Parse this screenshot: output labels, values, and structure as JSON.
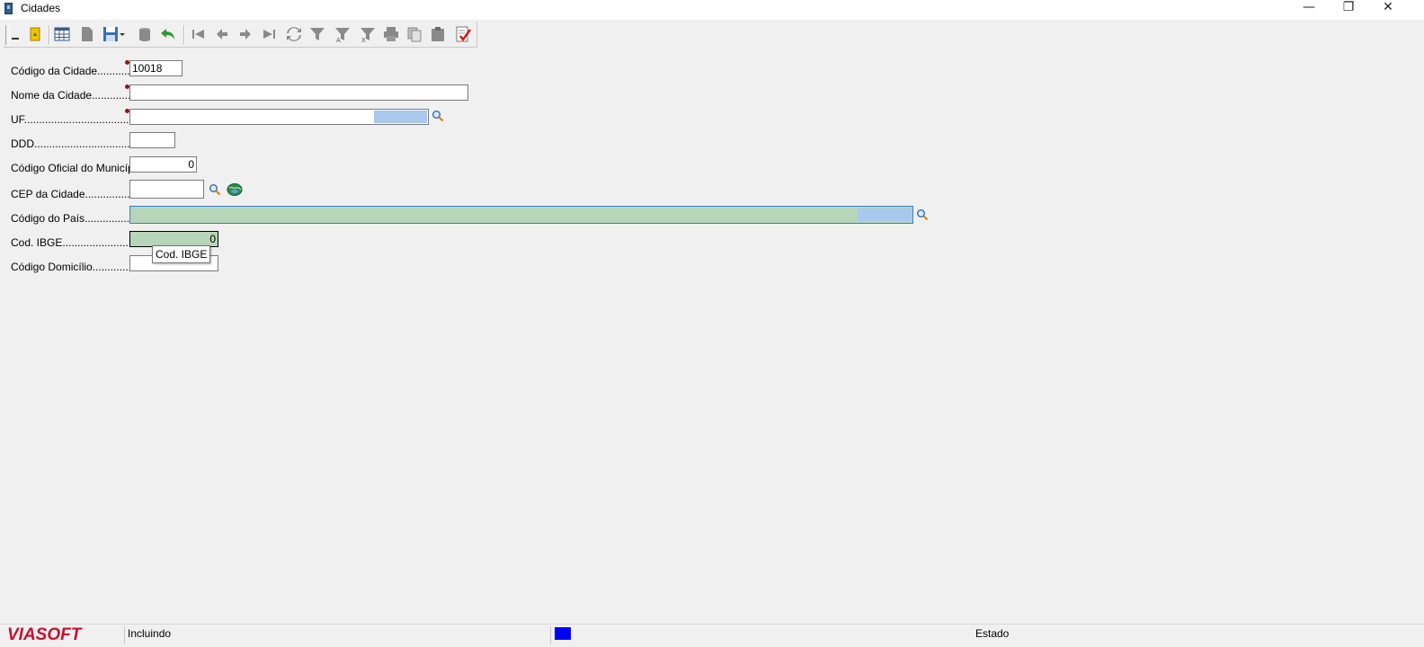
{
  "window": {
    "title": "Cidades",
    "minimize_glyph": "—",
    "restore_glyph": "❐",
    "close_glyph": "✕"
  },
  "toolbar": {
    "buttons": [
      {
        "name": "first-record",
        "icon": "first-icon"
      },
      {
        "name": "prior-record",
        "icon": "prior-icon"
      },
      {
        "name": "next-record",
        "icon": "next-icon"
      },
      {
        "name": "last-record",
        "icon": "last-icon"
      }
    ]
  },
  "form": {
    "codigo_cidade": {
      "label": "Código da Cidade",
      "dots": ".................",
      "value": "10018"
    },
    "nome_cidade": {
      "label": "Nome da Cidade",
      "dots": "..................",
      "value": ""
    },
    "uf": {
      "label": "UF",
      "dots": ".........................................",
      "value": ""
    },
    "ddd": {
      "label": "DDD",
      "dots": ".......................................",
      "value": ""
    },
    "codigo_oficial": {
      "label": "Código Oficial do Município",
      "dots": "",
      "value": "0"
    },
    "cep": {
      "label": "CEP da Cidade",
      "dots": ".....................",
      "value": ""
    },
    "codigo_pais": {
      "label": "Código do País",
      "dots": "....................",
      "value": ""
    },
    "cod_ibge": {
      "label": "Cod. IBGE",
      "dots": "............................",
      "value": "0"
    },
    "codigo_domicilio": {
      "label": "Código Domicílio",
      "dots": "..................",
      "value": ""
    }
  },
  "tooltip": {
    "text": "Cod. IBGE"
  },
  "statusbar": {
    "logo": "VIASOFT",
    "mode": "Incluindo",
    "field": "Estado"
  },
  "colors": {
    "required_dot": "#8b1a1a",
    "focused_field": "#b7d6b7",
    "lookup_selection": "#a8c8ec",
    "status_indicator": "#0000ff",
    "logo": "#c8102e"
  }
}
